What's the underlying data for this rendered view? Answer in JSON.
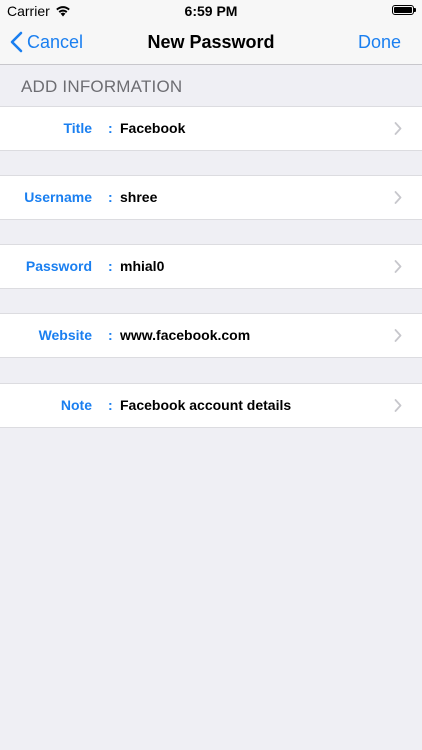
{
  "status_bar": {
    "carrier": "Carrier",
    "time": "6:59 PM",
    "icons": [
      "wifi-icon",
      "battery-icon"
    ]
  },
  "nav": {
    "back_icon": "chevron-left-icon",
    "cancel_label": "Cancel",
    "title": "New Password",
    "done_label": "Done"
  },
  "section": {
    "header": "ADD INFORMATION"
  },
  "fields": [
    {
      "label": "Title",
      "colon": ":",
      "value": "Facebook"
    },
    {
      "label": "Username",
      "colon": ":",
      "value": "shree"
    },
    {
      "label": "Password",
      "colon": ":",
      "value": "mhial0"
    },
    {
      "label": "Website",
      "colon": ":",
      "value": "www.facebook.com"
    },
    {
      "label": "Note",
      "colon": ":",
      "value": "Facebook account details"
    }
  ],
  "colors": {
    "accent": "#1a7ff0",
    "background": "#efeff4",
    "section_header": "#6d6d72"
  }
}
